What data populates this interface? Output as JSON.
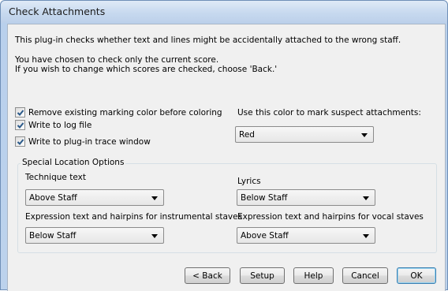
{
  "window": {
    "title": "Check Attachments"
  },
  "intro": {
    "line1": "This plug-in checks whether text and lines might be accidentally attached to the wrong staff.",
    "line2": "You have chosen to check only the current score.",
    "line3": "If you wish to change which scores are checked, choose 'Back.'"
  },
  "options": {
    "remove_marking": {
      "label": "Remove existing marking color before coloring",
      "checked": true
    },
    "write_log": {
      "label": "Write to log file",
      "checked": true
    },
    "write_trace": {
      "label": "Write to plug-in trace window",
      "checked": true
    }
  },
  "color": {
    "label": "Use this color to mark suspect attachments:",
    "value": "Red"
  },
  "special": {
    "legend": "Special Location Options",
    "technique": {
      "label": "Technique text",
      "value": "Above Staff"
    },
    "lyrics": {
      "label": "Lyrics",
      "value": "Below Staff"
    },
    "expr_instr": {
      "label": "Expression text and hairpins for instrumental staves",
      "value": "Below Staff"
    },
    "expr_vocal": {
      "label": "Expression text and hairpins for vocal staves",
      "value": "Above Staff"
    }
  },
  "buttons": {
    "back": "< Back",
    "setup": "Setup",
    "help": "Help",
    "cancel": "Cancel",
    "ok": "OK"
  }
}
